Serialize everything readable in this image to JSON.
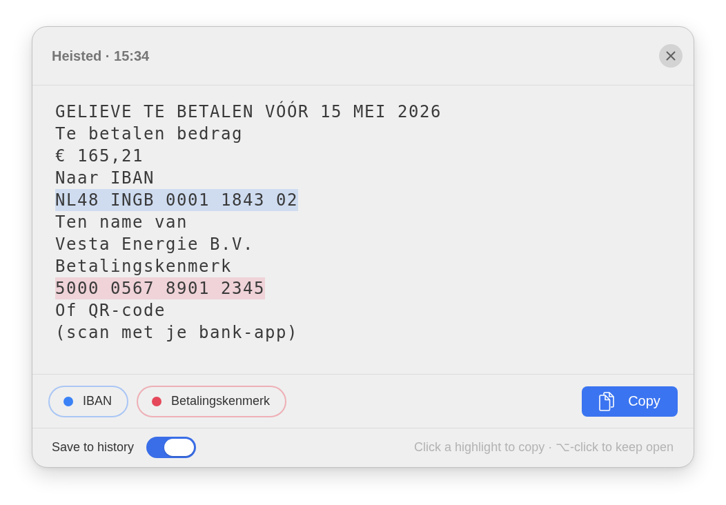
{
  "window": {
    "title": "Heisted · 15:34"
  },
  "content": {
    "lines": [
      {
        "text": "GELIEVE TE BETALEN VÓÓR 15 MEI 2026",
        "highlighted": false
      },
      {
        "text": "Te betalen bedrag",
        "highlighted": false
      },
      {
        "text": "€ 165,21",
        "highlighted": false
      },
      {
        "text": "Naar IBAN",
        "highlighted": false
      },
      {
        "text": "NL48 INGB 0001 1843 02",
        "highlighted": true,
        "color": "#cfdcf0"
      },
      {
        "text": "Ten name van",
        "highlighted": false
      },
      {
        "text": "Vesta Energie B.V.",
        "highlighted": false
      },
      {
        "text": "Betalingskenmerk",
        "highlighted": false
      },
      {
        "text": "5000 0567 8901 2345",
        "highlighted": true,
        "color": "#efd3d8"
      },
      {
        "text": "Of QR-code",
        "highlighted": false
      },
      {
        "text": "(scan met je bank-app)",
        "highlighted": false
      }
    ]
  },
  "highlights": [
    {
      "label": "IBAN",
      "color": "#3b82f6"
    },
    {
      "label": "Betalingskenmerk",
      "color": "#e5485a"
    }
  ],
  "copy_button": {
    "label": "Copy"
  },
  "save_to_history": {
    "label": "Save to history",
    "on": true
  },
  "hint": "Click a highlight to copy · ⌥-click to keep open"
}
